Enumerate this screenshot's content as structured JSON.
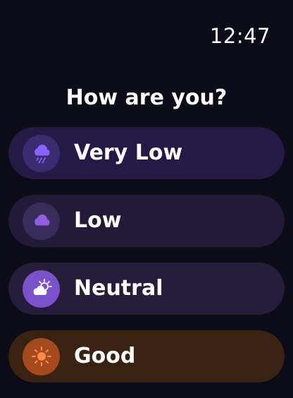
{
  "status": {
    "time": "12:47"
  },
  "prompt": "How are you?",
  "moods": [
    {
      "label": "Very Low",
      "icon": "rain-cloud-icon",
      "color": "#8a62ff"
    },
    {
      "label": "Low",
      "icon": "cloud-icon",
      "color": "#8f5fe0"
    },
    {
      "label": "Neutral",
      "icon": "sun-behind-cloud-icon",
      "color": "#c9a6ff"
    },
    {
      "label": "Good",
      "icon": "sun-icon",
      "color": "#ff7a3a"
    }
  ]
}
